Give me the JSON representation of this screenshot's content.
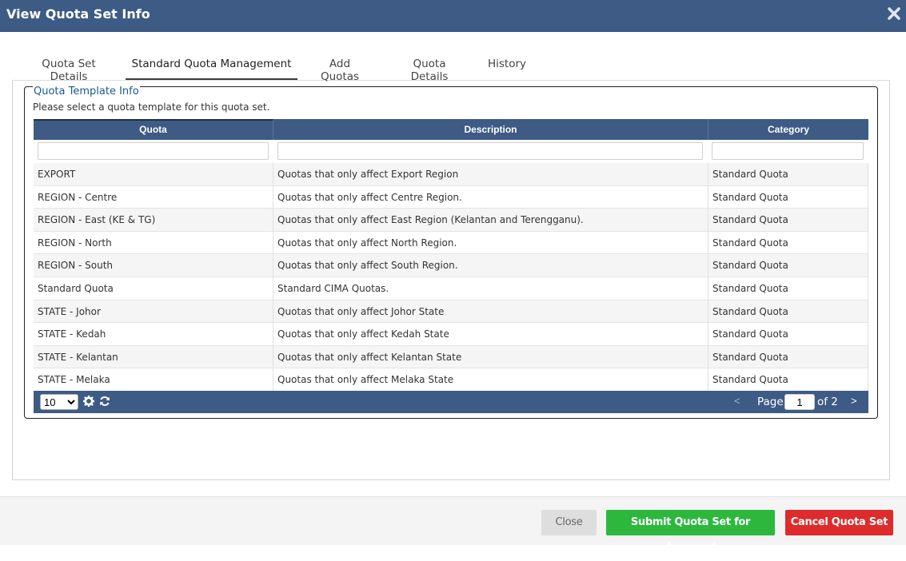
{
  "window": {
    "title": "View Quota Set Info"
  },
  "tabs": [
    {
      "label": "Quota Set Details"
    },
    {
      "label": "Standard Quota Management"
    },
    {
      "label": "Add Quotas"
    },
    {
      "label": "Quota Details"
    },
    {
      "label": "History"
    }
  ],
  "active_tab": "Standard Quota Management",
  "template_info": {
    "legend": "Quota Template Info",
    "help": "Please select a quota template for this quota set."
  },
  "grid": {
    "columns": [
      "Quota",
      "Description",
      "Category"
    ],
    "rows": [
      {
        "quota": "EXPORT",
        "description": "Quotas that only affect Export Region",
        "category": "Standard Quota"
      },
      {
        "quota": "REGION - Centre",
        "description": "Quotas that only affect Centre Region.",
        "category": "Standard Quota"
      },
      {
        "quota": "REGION - East (KE & TG)",
        "description": "Quotas that only affect East Region (Kelantan and Terengganu).",
        "category": "Standard Quota"
      },
      {
        "quota": "REGION - North",
        "description": "Quotas that only affect North Region.",
        "category": "Standard Quota"
      },
      {
        "quota": "REGION - South",
        "description": "Quotas that only affect South Region.",
        "category": "Standard Quota"
      },
      {
        "quota": "Standard Quota",
        "description": "Standard CIMA Quotas.",
        "category": "Standard Quota"
      },
      {
        "quota": "STATE - Johor",
        "description": "Quotas that only affect Johor State",
        "category": "Standard Quota"
      },
      {
        "quota": "STATE - Kedah",
        "description": "Quotas that only affect Kedah State",
        "category": "Standard Quota"
      },
      {
        "quota": "STATE - Kelantan",
        "description": "Quotas that only affect Kelantan State",
        "category": "Standard Quota"
      },
      {
        "quota": "STATE - Melaka",
        "description": "Quotas that only affect Melaka State",
        "category": "Standard Quota"
      }
    ]
  },
  "pager": {
    "page_size": "10",
    "prev": "<",
    "page_label": "Page",
    "current_page": "1",
    "of_label": "of 2",
    "next": ">"
  },
  "footer": {
    "close_label": "Close",
    "submit_label": "Submit Quota Set for Approval",
    "cancel_label": "Cancel Quota Set"
  },
  "colors": {
    "header": "#3e5b85",
    "submit": "#2db83d",
    "cancel": "#de2b2b"
  }
}
